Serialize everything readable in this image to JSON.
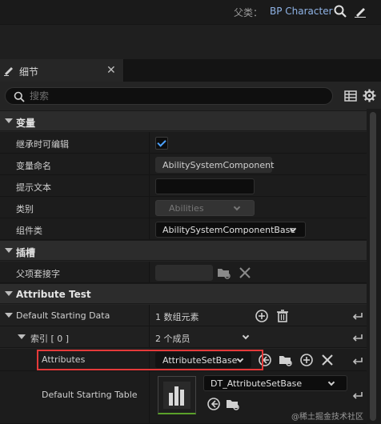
{
  "header": {
    "parent_label": "父类：",
    "parent_class": "BP Character"
  },
  "tab": {
    "label": "细节"
  },
  "search": {
    "placeholder": "搜索"
  },
  "sections": {
    "variable": "变量",
    "socket": "插槽",
    "attribute_test": "Attribute Test"
  },
  "rows": {
    "editable_label": "继承时可编辑",
    "editable_checked": true,
    "var_name_label": "变量命名",
    "var_name_value": "AbilitySystemComponent",
    "tooltip_label": "提示文本",
    "tooltip_value": "",
    "category_label": "类别",
    "category_value": "Abilities",
    "component_class_label": "组件类",
    "component_class_value": "AbilitySystemComponentBase",
    "parent_socket_label": "父项套接字",
    "default_data_label": "Default Starting Data",
    "default_data_value": "1 数组元素",
    "index_label": "索引 [ 0 ]",
    "index_value": "2 个成员",
    "attributes_label": "Attributes",
    "attributes_value": "AttributeSetBase",
    "table_label": "Default Starting Table",
    "table_value": "DT_AttributeSetBase"
  },
  "watermark": "@稀土掘金技术社区",
  "colors": {
    "accent_link": "#8fb3e6",
    "checkbox": "#4da3ff",
    "highlight": "#e53a3a",
    "thumbnail_bar": "#5aa12a"
  }
}
